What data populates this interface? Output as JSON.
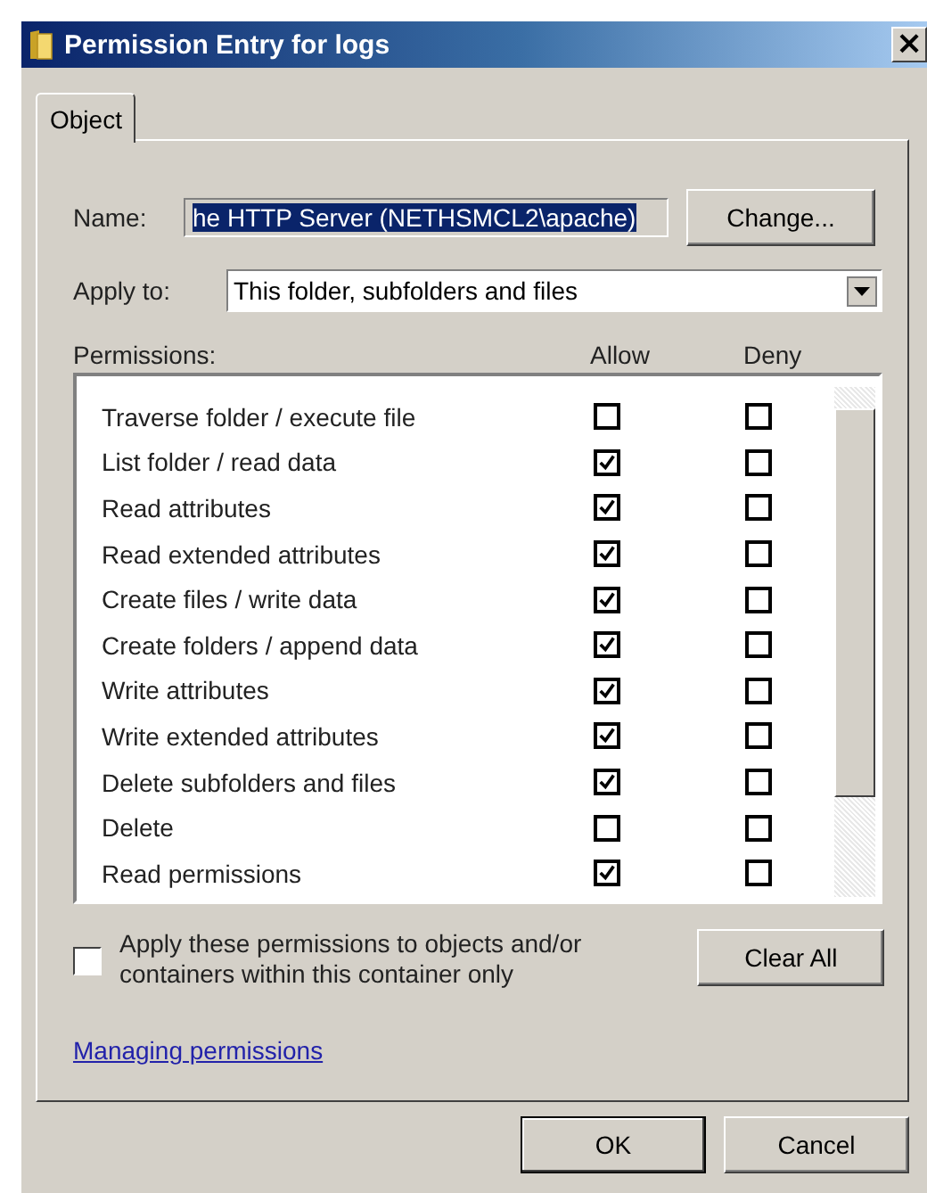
{
  "window": {
    "title": "Permission Entry for logs",
    "close": "×"
  },
  "tabs": [
    {
      "label": "Object",
      "selected": true
    }
  ],
  "name_field": {
    "label": "Name:",
    "value": "he HTTP Server (NETHSMCL2\\apache)",
    "button": "Change..."
  },
  "apply_to": {
    "label": "Apply to:",
    "value": "This folder, subfolders and files"
  },
  "permissions": {
    "label": "Permissions:",
    "allow_label": "Allow",
    "deny_label": "Deny",
    "rows": [
      {
        "name": "Traverse folder / execute file",
        "allow": false,
        "deny": false
      },
      {
        "name": "List folder / read data",
        "allow": true,
        "deny": false
      },
      {
        "name": "Read attributes",
        "allow": true,
        "deny": false
      },
      {
        "name": "Read extended attributes",
        "allow": true,
        "deny": false
      },
      {
        "name": "Create files / write data",
        "allow": true,
        "deny": false
      },
      {
        "name": "Create folders / append data",
        "allow": true,
        "deny": false
      },
      {
        "name": "Write attributes",
        "allow": true,
        "deny": false
      },
      {
        "name": "Write extended attributes",
        "allow": true,
        "deny": false
      },
      {
        "name": "Delete subfolders and files",
        "allow": true,
        "deny": false
      },
      {
        "name": "Delete",
        "allow": false,
        "deny": false
      },
      {
        "name": "Read permissions",
        "allow": true,
        "deny": false
      }
    ]
  },
  "apply_inside": {
    "label": "Apply these permissions to objects and/or containers within this container only",
    "checked": false
  },
  "clear_all": "Clear All",
  "help_link": "Managing permissions",
  "buttons": [
    {
      "label": "OK",
      "default": true
    },
    {
      "label": "Cancel",
      "default": false
    }
  ]
}
